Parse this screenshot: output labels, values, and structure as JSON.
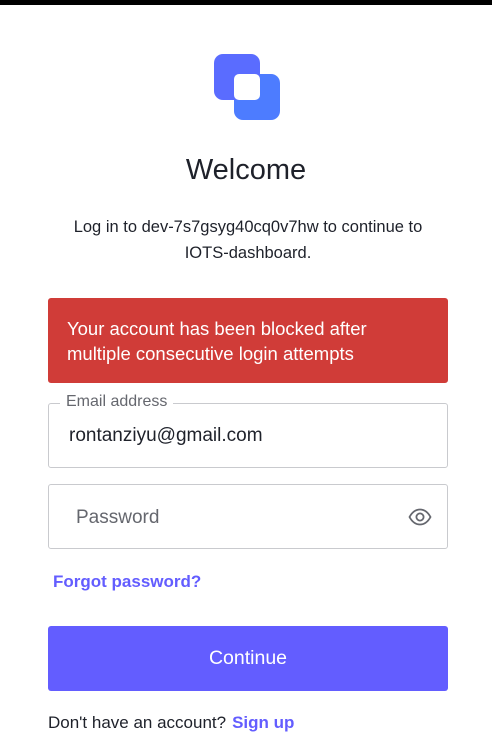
{
  "colors": {
    "accent": "#635dff",
    "error": "#d03c38",
    "logo_primary": "#3a5cff",
    "logo_secondary": "#4d7cff"
  },
  "logo": {
    "icon": "app-logo-icon"
  },
  "header": {
    "title": "Welcome",
    "subtitle_line1": "Log in to dev-7s7gsyg40cq0v7hw to continue to",
    "subtitle_line2": "IOTS-dashboard."
  },
  "error": {
    "line1": "Your account has been blocked after",
    "line2": "multiple consecutive login attempts"
  },
  "form": {
    "email": {
      "label": "Email address",
      "value": "rontanziyu@gmail.com"
    },
    "password": {
      "placeholder": "Password",
      "toggle_icon": "eye-icon"
    },
    "forgot_label": "Forgot password?",
    "submit_label": "Continue"
  },
  "footer": {
    "prompt": "Don't have an account?",
    "signup_label": "Sign up"
  }
}
